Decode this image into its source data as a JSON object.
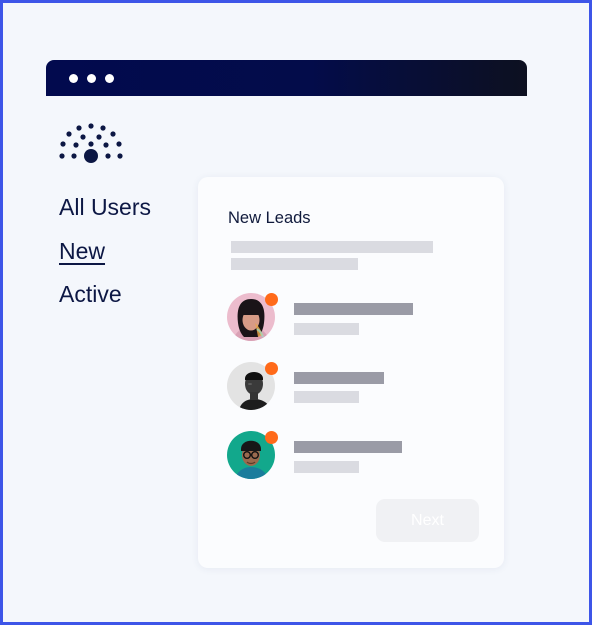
{
  "sidebar": {
    "items": [
      {
        "label": "All Users",
        "active": false
      },
      {
        "label": "New",
        "active": true
      },
      {
        "label": "Active",
        "active": false
      }
    ]
  },
  "card": {
    "title": "New Leads",
    "leads": [
      {
        "avatar": "woman-with-bangs-avatar",
        "status_color": "#ff6a1a"
      },
      {
        "avatar": "man-black-and-white-avatar",
        "status_color": "#ff6a1a"
      },
      {
        "avatar": "man-with-glasses-avatar",
        "status_color": "#ff6a1a"
      }
    ],
    "next_label": "Next"
  },
  "colors": {
    "frame_border": "#3d55e8",
    "titlebar": "#020a4e",
    "text_primary": "#0c1744",
    "status_dot": "#ff6a1a",
    "placeholder_dark": "#9a9ba6",
    "placeholder_light": "#dadbe1"
  }
}
